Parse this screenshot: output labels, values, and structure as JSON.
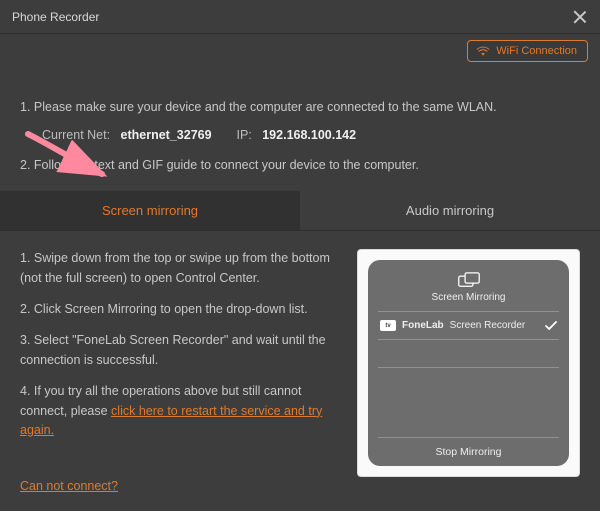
{
  "title": "Phone Recorder",
  "wifi_button": "WiFi Connection",
  "step1": "1. Please make sure your device and the computer are connected to the same WLAN.",
  "net_label": "Current Net:",
  "net_value": "ethernet_32769",
  "ip_label": "IP:",
  "ip_value": "192.168.100.142",
  "step2": "2. Follow the text and GIF guide to connect your device to the computer.",
  "tabs": {
    "screen": "Screen mirroring",
    "audio": "Audio mirroring"
  },
  "guide": {
    "s1": "1. Swipe down from the top or swipe up from the bottom (not the full screen) to open Control Center.",
    "s2": "2. Click Screen Mirroring to open the drop-down list.",
    "s3": "3. Select \"FoneLab Screen Recorder\" and wait until the connection is successful.",
    "s4a": "4. If you try all the operations above but still cannot connect, please ",
    "s4_link": "click here to restart the service and try again."
  },
  "control_center": {
    "title": "Screen Mirroring",
    "item_brand": "FoneLab",
    "item_name": "Screen Recorder",
    "stop": "Stop Mirroring"
  },
  "cannot_connect": "Can not connect?"
}
